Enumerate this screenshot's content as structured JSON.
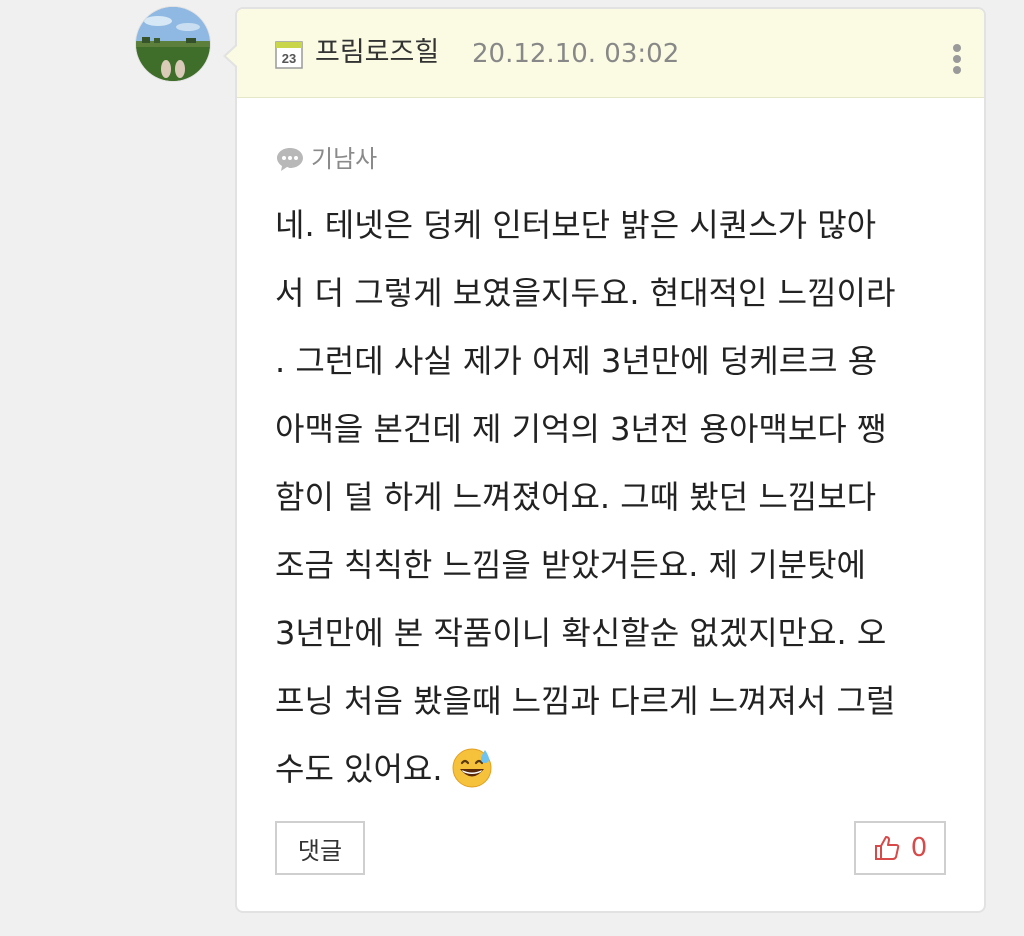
{
  "comment": {
    "author": "프림로즈힐",
    "date": "20.12.10. 03:02",
    "calendar_icon_text": "23",
    "reply_to": "기남사",
    "lines": [
      "네. 테넷은 덩케 인터보단 밝은 시퀀스가 많아",
      "서 더 그렇게 보였을지두요. 현대적인 느낌이라",
      ". 그런데 사실 제가 어제 3년만에 덩케르크 용",
      "아맥을 본건데 제 기억의 3년전 용아맥보다 쨍",
      "함이 덜 하게 느껴졌어요. 그때 봤던 느낌보다",
      "조금 칙칙한 느낌을 받았거든요.  제 기분탓에",
      "3년만에 본 작품이니 확신할순 없겠지만요. 오",
      "프닝 처음 봤을때 느낌과 다르게 느껴져서 그럴",
      "수도 있어요."
    ],
    "emoji": "grinning-face-with-sweat",
    "reply_button_label": "댓글",
    "like_count": "0"
  },
  "colors": {
    "page_background": "#f0f0f0",
    "header_background": "#fbfbe3",
    "like_accent": "#d84a4a",
    "date_text": "#888888"
  },
  "icons": {
    "calendar": "calendar-icon",
    "more": "more-vertical-icon",
    "speech": "speech-bubble-icon",
    "thumb": "thumbs-up-icon"
  }
}
